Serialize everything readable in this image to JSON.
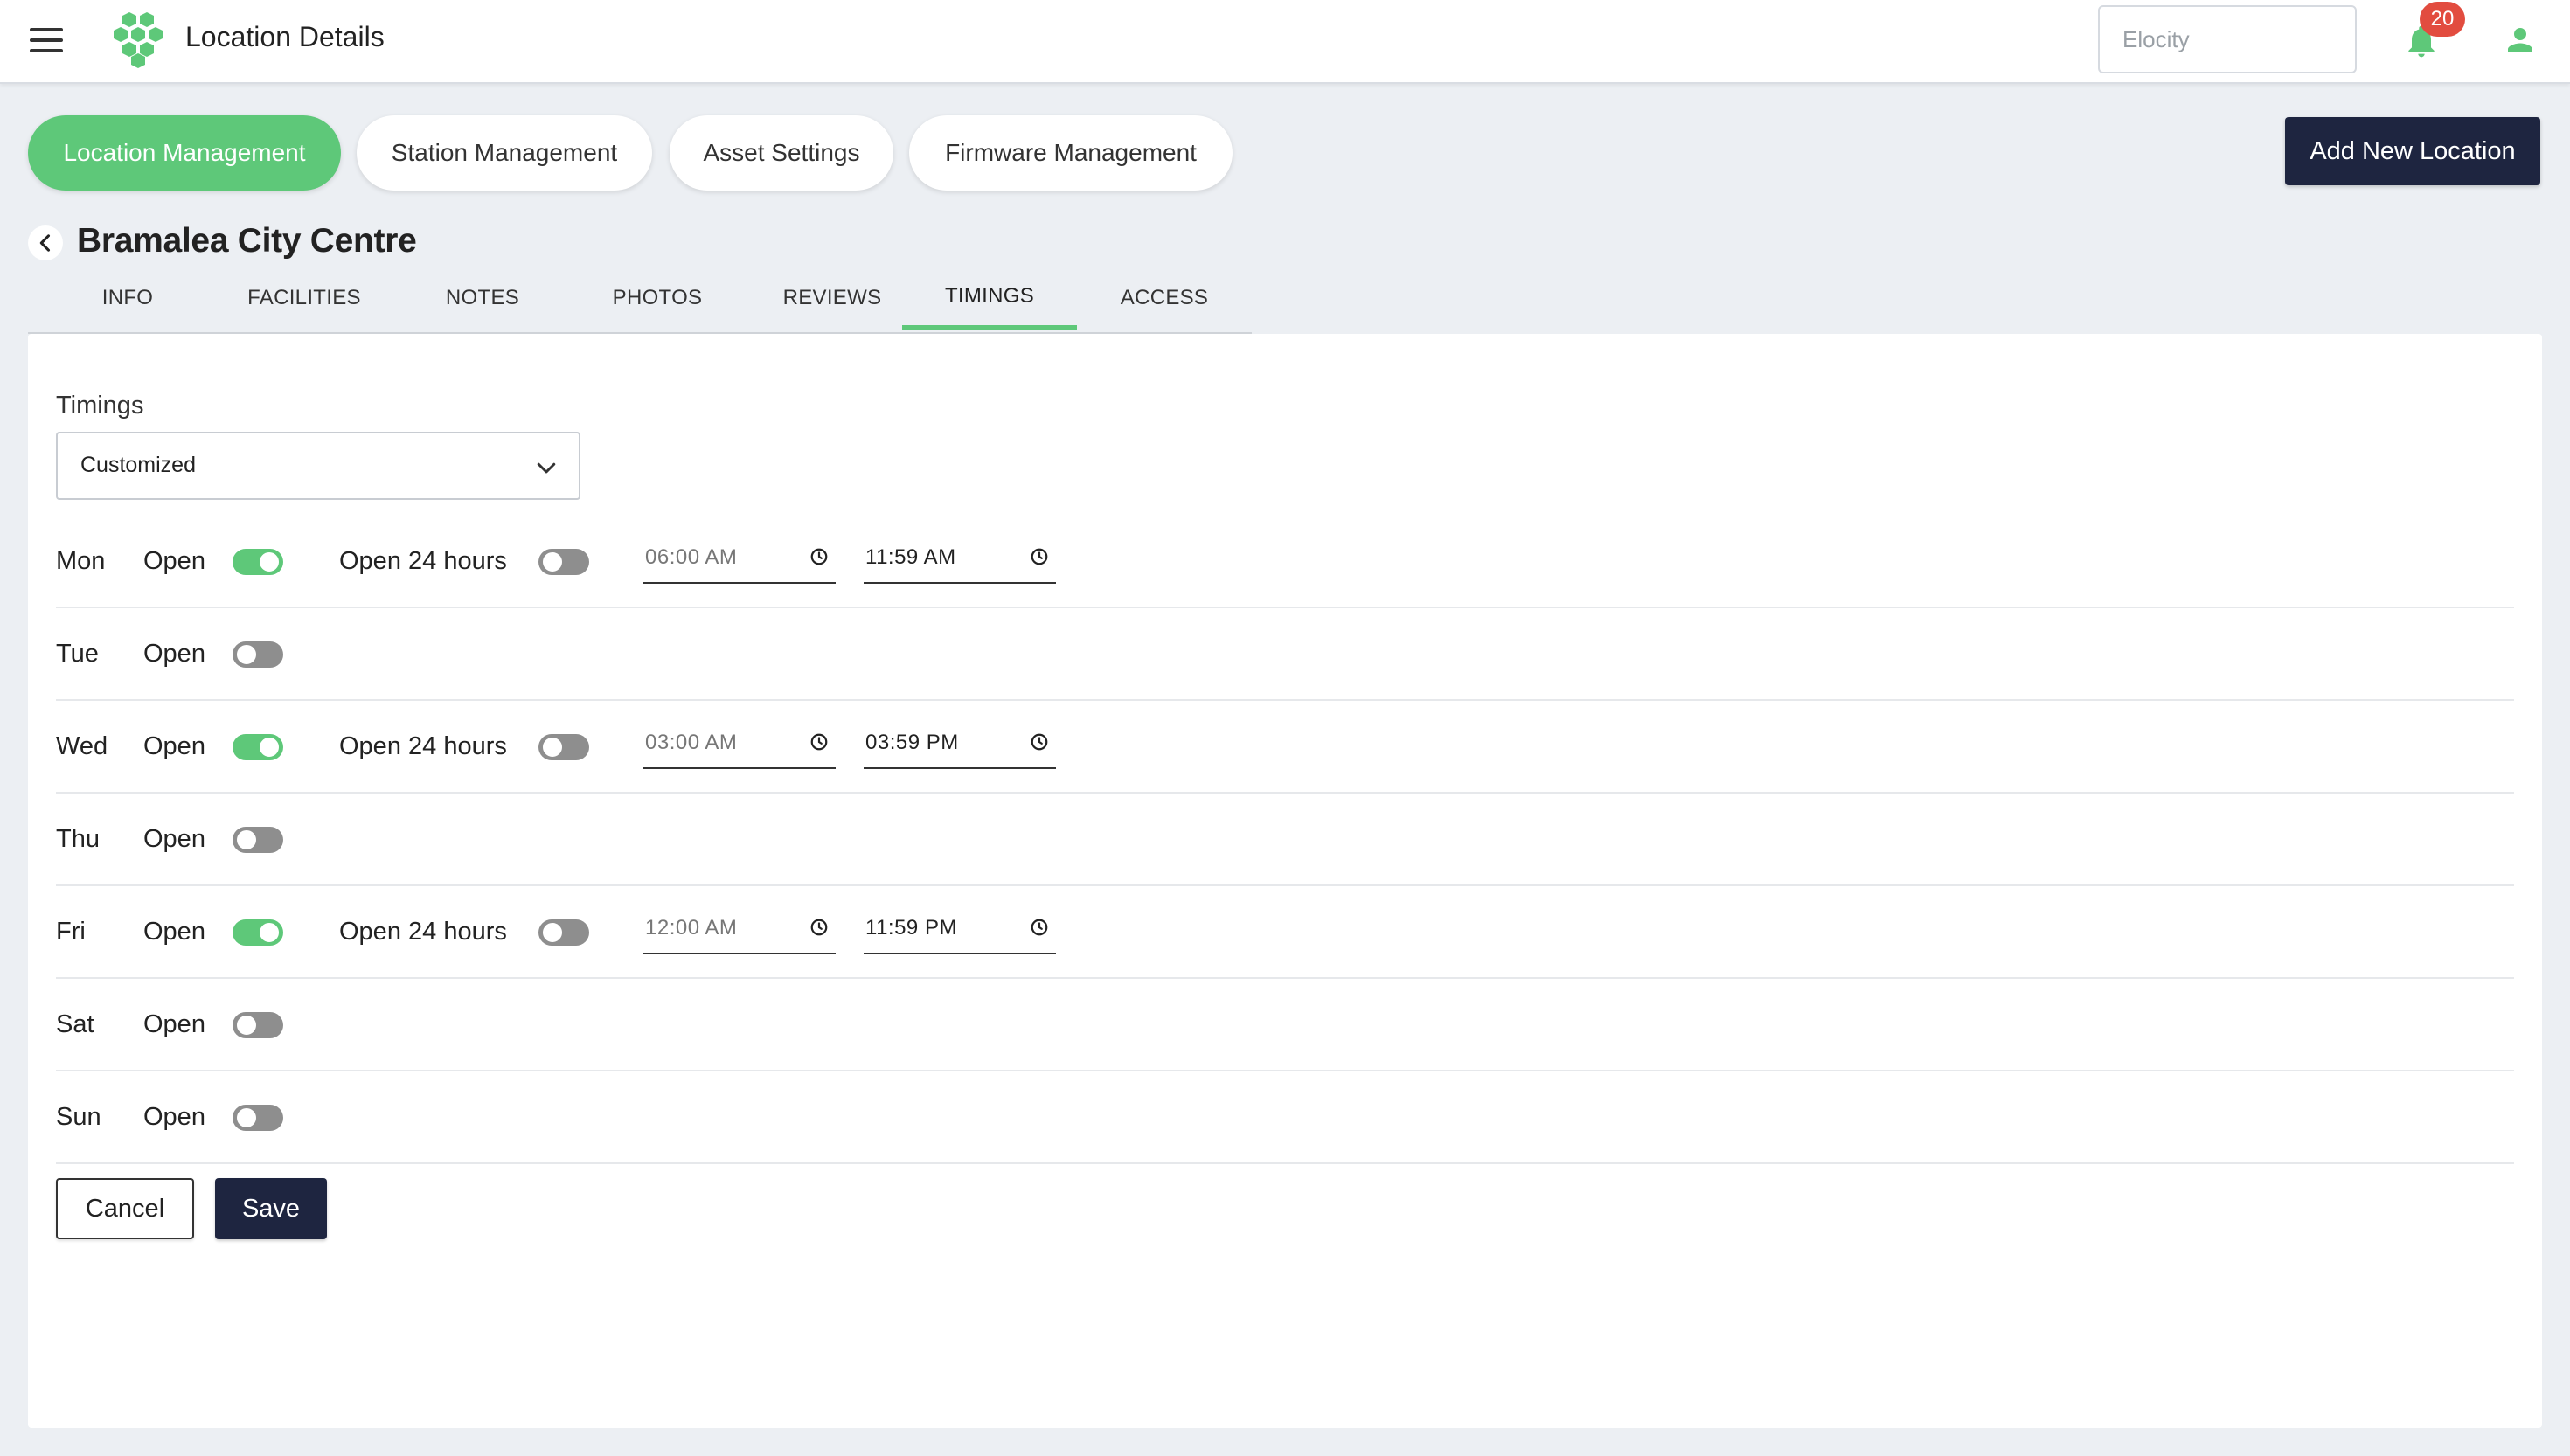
{
  "header": {
    "title": "Location Details",
    "search_placeholder": "Elocity",
    "notification_count": "20",
    "menu_icon": "hamburger-menu-icon",
    "logo_icon": "hexagon-cluster-logo",
    "bell_icon": "bell-icon",
    "user_icon": "user-icon"
  },
  "nav": {
    "pills": [
      {
        "label": "Location Management",
        "active": true
      },
      {
        "label": "Station Management",
        "active": false
      },
      {
        "label": "Asset Settings",
        "active": false
      },
      {
        "label": "Firmware Management",
        "active": false
      }
    ],
    "add_button": "Add New Location"
  },
  "location": {
    "name": "Bramalea City Centre",
    "back_icon": "chevron-left-icon"
  },
  "tabs": [
    {
      "label": "INFO",
      "active": false
    },
    {
      "label": "FACILITIES",
      "active": false
    },
    {
      "label": "NOTES",
      "active": false
    },
    {
      "label": "PHOTOS",
      "active": false
    },
    {
      "label": "REVIEWS",
      "active": false
    },
    {
      "label": "TIMINGS",
      "active": true
    },
    {
      "label": "ACCESS",
      "active": false
    }
  ],
  "timings": {
    "label": "Timings",
    "mode": "Customized",
    "open_label": "Open",
    "open_24_label": "Open 24 hours",
    "days": [
      {
        "day": "Mon",
        "open": true,
        "open_24": false,
        "start": "06:00 AM",
        "end": "11:59 AM"
      },
      {
        "day": "Tue",
        "open": false
      },
      {
        "day": "Wed",
        "open": true,
        "open_24": false,
        "start": "03:00 AM",
        "end": "03:59 PM"
      },
      {
        "day": "Thu",
        "open": false
      },
      {
        "day": "Fri",
        "open": true,
        "open_24": false,
        "start": "12:00 AM",
        "end": "11:59 PM"
      },
      {
        "day": "Sat",
        "open": false
      },
      {
        "day": "Sun",
        "open": false
      }
    ]
  },
  "actions": {
    "cancel": "Cancel",
    "save": "Save"
  },
  "colors": {
    "accent_green": "#5ec879",
    "navy": "#1e2540",
    "badge_red": "#e24c3f",
    "toggle_off": "#8e8e8e"
  }
}
